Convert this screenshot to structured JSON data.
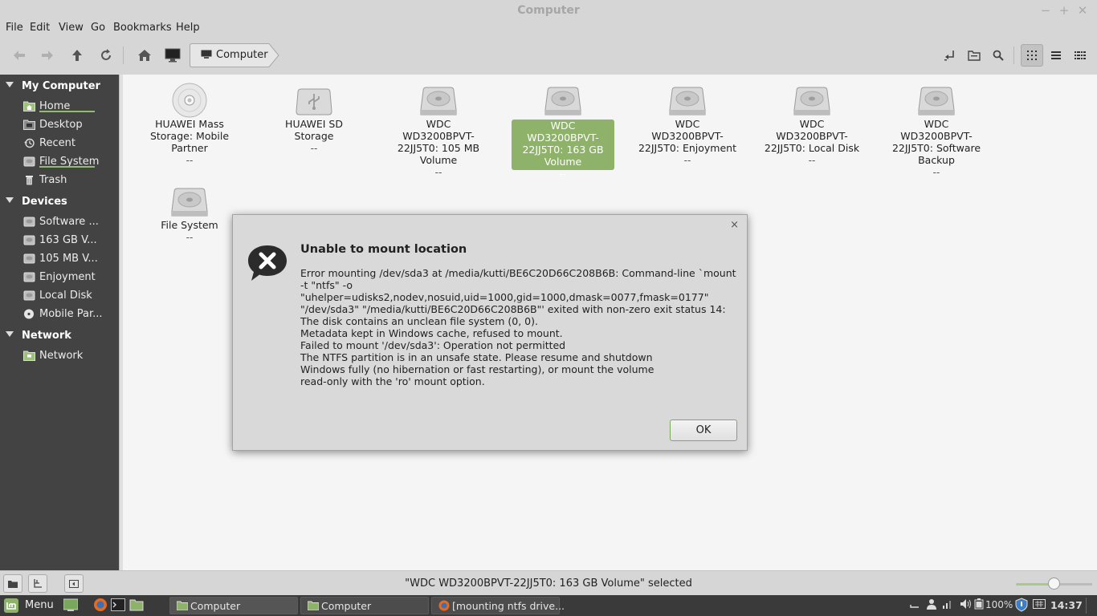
{
  "window": {
    "title": "Computer"
  },
  "menubar": [
    "File",
    "Edit",
    "View",
    "Go",
    "Bookmarks",
    "Help"
  ],
  "breadcrumb": {
    "label": "Computer"
  },
  "sidebar": {
    "sections": [
      {
        "title": "My Computer",
        "items": [
          {
            "label": "Home",
            "icon": "home-folder-icon"
          },
          {
            "label": "Desktop",
            "icon": "desktop-folder-icon"
          },
          {
            "label": "Recent",
            "icon": "recent-icon"
          },
          {
            "label": "File System",
            "icon": "drive-icon"
          },
          {
            "label": "Trash",
            "icon": "trash-icon"
          }
        ]
      },
      {
        "title": "Devices",
        "items": [
          {
            "label": "Software ...",
            "icon": "drive-icon"
          },
          {
            "label": "163 GB V...",
            "icon": "drive-icon"
          },
          {
            "label": "105 MB V...",
            "icon": "drive-icon"
          },
          {
            "label": "Enjoyment",
            "icon": "drive-icon"
          },
          {
            "label": "Local Disk",
            "icon": "drive-icon"
          },
          {
            "label": "Mobile Par...",
            "icon": "optical-disc-icon"
          }
        ]
      },
      {
        "title": "Network",
        "items": [
          {
            "label": "Network",
            "icon": "network-icon"
          }
        ]
      }
    ]
  },
  "items": [
    {
      "name": "HUAWEI Mass Storage: Mobile Partner",
      "size": "--",
      "icon": "optical-disc-icon"
    },
    {
      "name": "HUAWEI SD Storage",
      "size": "--",
      "icon": "usb-drive-icon"
    },
    {
      "name": "WDC WD3200BPVT-22JJ5T0: 105 MB Volume",
      "size": "--",
      "icon": "hard-drive-icon"
    },
    {
      "name": "WDC WD3200BPVT-22JJ5T0: 163 GB Volume",
      "size": "--",
      "icon": "hard-drive-icon",
      "selected": true
    },
    {
      "name": "WDC WD3200BPVT-22JJ5T0: Enjoyment",
      "size": "--",
      "icon": "hard-drive-icon"
    },
    {
      "name": "WDC WD3200BPVT-22JJ5T0: Local Disk",
      "size": "--",
      "icon": "hard-drive-icon"
    },
    {
      "name": "WDC WD3200BPVT-22JJ5T0: Software Backup",
      "size": "--",
      "icon": "hard-drive-icon"
    },
    {
      "name": "File System",
      "size": "--",
      "icon": "hard-drive-icon"
    }
  ],
  "dialog": {
    "title": "Unable to mount location",
    "message": "Error mounting /dev/sda3 at /media/kutti/BE6C20D66C208B6B: Command-line `mount -t \"ntfs\" -o \"uhelper=udisks2,nodev,nosuid,uid=1000,gid=1000,dmask=0077,fmask=0177\" \"/dev/sda3\" \"/media/kutti/BE6C20D66C208B6B\"' exited with non-zero exit status 14: The disk contains an unclean file system (0, 0).\nMetadata kept in Windows cache, refused to mount.\nFailed to mount '/dev/sda3': Operation not permitted\nThe NTFS partition is in an unsafe state. Please resume and shutdown\nWindows fully (no hibernation or fast restarting), or mount the volume\nread-only with the 'ro' mount option.",
    "ok_label": "OK",
    "close_glyph": "×",
    "icon": "error-speech-bubble-icon"
  },
  "status": {
    "text": "\"WDC WD3200BPVT-22JJ5T0: 163 GB Volume\" selected",
    "zoom_fraction": 0.5
  },
  "taskbar": {
    "menu_label": "Menu",
    "tasks": [
      "Computer",
      "Computer",
      "[mounting ntfs drive..."
    ],
    "battery": "100%",
    "clock": "14:37"
  },
  "colors": {
    "accent": "#8fb26a",
    "sidebar_bg": "#434343",
    "taskbar_bg": "#3a3a3a"
  }
}
